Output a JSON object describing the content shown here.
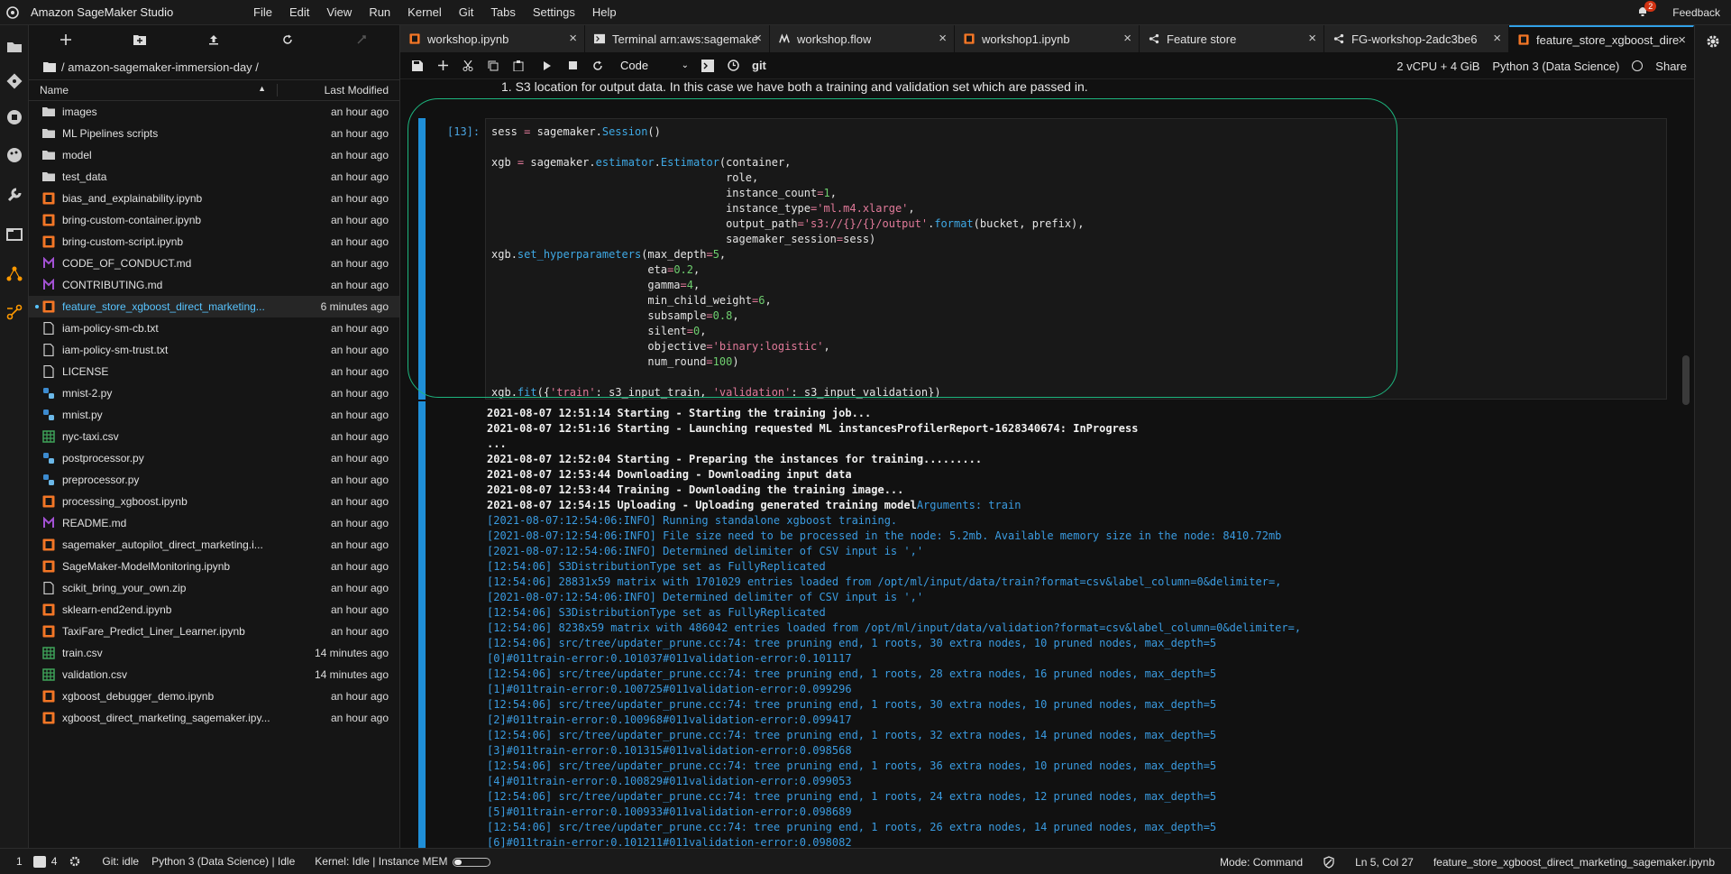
{
  "menubar": {
    "app_title": "Amazon SageMaker Studio",
    "menus": [
      "File",
      "Edit",
      "View",
      "Run",
      "Kernel",
      "Git",
      "Tabs",
      "Settings",
      "Help"
    ],
    "notification_count": "2",
    "feedback": "Feedback"
  },
  "filebrowser": {
    "breadcrumb": "/ amazon-sagemaker-immersion-day /",
    "col_name": "Name",
    "col_modified": "Last Modified",
    "files": [
      {
        "name": "images",
        "modified": "an hour ago",
        "icon": "folder-icon"
      },
      {
        "name": "ML Pipelines scripts",
        "modified": "an hour ago",
        "icon": "folder-icon"
      },
      {
        "name": "model",
        "modified": "an hour ago",
        "icon": "folder-icon"
      },
      {
        "name": "test_data",
        "modified": "an hour ago",
        "icon": "folder-icon"
      },
      {
        "name": "bias_and_explainability.ipynb",
        "modified": "an hour ago",
        "icon": "notebook-icon"
      },
      {
        "name": "bring-custom-container.ipynb",
        "modified": "an hour ago",
        "icon": "notebook-icon"
      },
      {
        "name": "bring-custom-script.ipynb",
        "modified": "an hour ago",
        "icon": "notebook-icon"
      },
      {
        "name": "CODE_OF_CONDUCT.md",
        "modified": "an hour ago",
        "icon": "markdown-icon"
      },
      {
        "name": "CONTRIBUTING.md",
        "modified": "an hour ago",
        "icon": "markdown-icon"
      },
      {
        "name": "feature_store_xgboost_direct_marketing...",
        "modified": "6 minutes ago",
        "icon": "notebook-icon"
      },
      {
        "name": "iam-policy-sm-cb.txt",
        "modified": "an hour ago",
        "icon": "file-icon"
      },
      {
        "name": "iam-policy-sm-trust.txt",
        "modified": "an hour ago",
        "icon": "file-icon"
      },
      {
        "name": "LICENSE",
        "modified": "an hour ago",
        "icon": "file-icon"
      },
      {
        "name": "mnist-2.py",
        "modified": "an hour ago",
        "icon": "python-icon"
      },
      {
        "name": "mnist.py",
        "modified": "an hour ago",
        "icon": "python-icon"
      },
      {
        "name": "nyc-taxi.csv",
        "modified": "an hour ago",
        "icon": "csv-icon"
      },
      {
        "name": "postprocessor.py",
        "modified": "an hour ago",
        "icon": "python-icon"
      },
      {
        "name": "preprocessor.py",
        "modified": "an hour ago",
        "icon": "python-icon"
      },
      {
        "name": "processing_xgboost.ipynb",
        "modified": "an hour ago",
        "icon": "notebook-icon"
      },
      {
        "name": "README.md",
        "modified": "an hour ago",
        "icon": "markdown-icon"
      },
      {
        "name": "sagemaker_autopilot_direct_marketing.i...",
        "modified": "an hour ago",
        "icon": "notebook-icon"
      },
      {
        "name": "SageMaker-ModelMonitoring.ipynb",
        "modified": "an hour ago",
        "icon": "notebook-icon"
      },
      {
        "name": "scikit_bring_your_own.zip",
        "modified": "an hour ago",
        "icon": "file-icon"
      },
      {
        "name": "sklearn-end2end.ipynb",
        "modified": "an hour ago",
        "icon": "notebook-icon"
      },
      {
        "name": "TaxiFare_Predict_Liner_Learner.ipynb",
        "modified": "an hour ago",
        "icon": "notebook-icon"
      },
      {
        "name": "train.csv",
        "modified": "14 minutes ago",
        "icon": "csv-icon"
      },
      {
        "name": "validation.csv",
        "modified": "14 minutes ago",
        "icon": "csv-icon"
      },
      {
        "name": "xgboost_debugger_demo.ipynb",
        "modified": "an hour ago",
        "icon": "notebook-icon"
      },
      {
        "name": "xgboost_direct_marketing_sagemaker.ipy...",
        "modified": "an hour ago",
        "icon": "notebook-icon"
      }
    ]
  },
  "tabs": [
    {
      "label": "workshop.ipynb",
      "icon": "notebook-icon"
    },
    {
      "label": "Terminal arn:aws:sagemake",
      "icon": "terminal-icon"
    },
    {
      "label": "workshop.flow",
      "icon": "flow-icon"
    },
    {
      "label": "workshop1.ipynb",
      "icon": "notebook-icon"
    },
    {
      "label": "Feature store",
      "icon": "feature-store-icon"
    },
    {
      "label": "FG-workshop-2adc3be6",
      "icon": "feature-group-icon"
    },
    {
      "label": "feature_store_xgboost_dire",
      "icon": "notebook-icon"
    }
  ],
  "nbtoolbar": {
    "cell_type": "Code",
    "git": "git",
    "instance": "2 vCPU + 4 GiB",
    "kernel": "Python 3 (Data Science)",
    "share": "Share"
  },
  "notebook": {
    "markdown_line": "1. S3 location for output data. In this case we have both a training and validation set which are passed in.",
    "prompt": "[13]:",
    "output_lines": [
      {
        "t": "2021-08-07 12:51:14 Starting - Starting the training job...",
        "c": "stdout"
      },
      {
        "t": "2021-08-07 12:51:16 Starting - Launching requested ML instancesProfilerReport-1628340674: InProgress",
        "c": "stdout"
      },
      {
        "t": "...",
        "c": "stdout"
      },
      {
        "t": "2021-08-07 12:52:04 Starting - Preparing the instances for training.........",
        "c": "stdout"
      },
      {
        "t": "2021-08-07 12:53:44 Downloading - Downloading input data",
        "c": "stdout"
      },
      {
        "t": "2021-08-07 12:53:44 Training - Downloading the training image...",
        "c": "stdout"
      },
      {
        "t": "2021-08-07 12:54:15 Uploading - Uploading generated training model",
        "c": "stdout",
        "tail": "Arguments: train"
      },
      {
        "t": "[2021-08-07:12:54:06:INFO] Running standalone xgboost training.",
        "c": "log"
      },
      {
        "t": "[2021-08-07:12:54:06:INFO] File size need to be processed in the node: 5.2mb. Available memory size in the node: 8410.72mb",
        "c": "log"
      },
      {
        "t": "[2021-08-07:12:54:06:INFO] Determined delimiter of CSV input is ','",
        "c": "log"
      },
      {
        "t": "[12:54:06] S3DistributionType set as FullyReplicated",
        "c": "log"
      },
      {
        "t": "[12:54:06] 28831x59 matrix with 1701029 entries loaded from /opt/ml/input/data/train?format=csv&label_column=0&delimiter=,",
        "c": "log"
      },
      {
        "t": "[2021-08-07:12:54:06:INFO] Determined delimiter of CSV input is ','",
        "c": "log"
      },
      {
        "t": "[12:54:06] S3DistributionType set as FullyReplicated",
        "c": "log"
      },
      {
        "t": "[12:54:06] 8238x59 matrix with 486042 entries loaded from /opt/ml/input/data/validation?format=csv&label_column=0&delimiter=,",
        "c": "log"
      },
      {
        "t": "[12:54:06] src/tree/updater_prune.cc:74: tree pruning end, 1 roots, 30 extra nodes, 10 pruned nodes, max_depth=5",
        "c": "log"
      },
      {
        "t": "[0]#011train-error:0.101037#011validation-error:0.101117",
        "c": "log"
      },
      {
        "t": "[12:54:06] src/tree/updater_prune.cc:74: tree pruning end, 1 roots, 28 extra nodes, 16 pruned nodes, max_depth=5",
        "c": "log"
      },
      {
        "t": "[1]#011train-error:0.100725#011validation-error:0.099296",
        "c": "log"
      },
      {
        "t": "[12:54:06] src/tree/updater_prune.cc:74: tree pruning end, 1 roots, 30 extra nodes, 10 pruned nodes, max_depth=5",
        "c": "log"
      },
      {
        "t": "[2]#011train-error:0.100968#011validation-error:0.099417",
        "c": "log"
      },
      {
        "t": "[12:54:06] src/tree/updater_prune.cc:74: tree pruning end, 1 roots, 32 extra nodes, 14 pruned nodes, max_depth=5",
        "c": "log"
      },
      {
        "t": "[3]#011train-error:0.101315#011validation-error:0.098568",
        "c": "log"
      },
      {
        "t": "[12:54:06] src/tree/updater_prune.cc:74: tree pruning end, 1 roots, 36 extra nodes, 10 pruned nodes, max_depth=5",
        "c": "log"
      },
      {
        "t": "[4]#011train-error:0.100829#011validation-error:0.099053",
        "c": "log"
      },
      {
        "t": "[12:54:06] src/tree/updater_prune.cc:74: tree pruning end, 1 roots, 24 extra nodes, 12 pruned nodes, max_depth=5",
        "c": "log"
      },
      {
        "t": "[5]#011train-error:0.100933#011validation-error:0.098689",
        "c": "log"
      },
      {
        "t": "[12:54:06] src/tree/updater_prune.cc:74: tree pruning end, 1 roots, 26 extra nodes, 14 pruned nodes, max_depth=5",
        "c": "log"
      },
      {
        "t": "[6]#011train-error:0.101211#011validation-error:0.098082",
        "c": "log"
      }
    ]
  },
  "code_lines": [
    [
      [
        "sess ",
        ""
      ],
      [
        "=",
        "op"
      ],
      [
        " sagemaker",
        ""
      ],
      [
        ".",
        ""
      ],
      [
        "Session",
        "kw"
      ],
      [
        "()",
        ""
      ]
    ],
    [],
    [
      [
        "xgb ",
        ""
      ],
      [
        "=",
        "op"
      ],
      [
        " sagemaker",
        ""
      ],
      [
        ".",
        ""
      ],
      [
        "estimator",
        "kw"
      ],
      [
        ".",
        ""
      ],
      [
        "Estimator",
        "kw"
      ],
      [
        "(container,",
        ""
      ]
    ],
    [
      [
        "                                    role,",
        ""
      ]
    ],
    [
      [
        "                                    instance_count",
        ""
      ],
      [
        "=",
        "op"
      ],
      [
        "1",
        "num"
      ],
      [
        ",",
        ""
      ]
    ],
    [
      [
        "                                    instance_type",
        ""
      ],
      [
        "=",
        "op"
      ],
      [
        "'ml.m4.xlarge'",
        "str"
      ],
      [
        ",",
        ""
      ]
    ],
    [
      [
        "                                    output_path",
        ""
      ],
      [
        "=",
        "op"
      ],
      [
        "'s3://{}/{}/output'",
        "str"
      ],
      [
        ".",
        ""
      ],
      [
        "format",
        "kw"
      ],
      [
        "(bucket, prefix),",
        ""
      ]
    ],
    [
      [
        "                                    sagemaker_session",
        ""
      ],
      [
        "=",
        "op"
      ],
      [
        "sess)",
        ""
      ]
    ],
    [
      [
        "xgb",
        ""
      ],
      [
        ".",
        ""
      ],
      [
        "set_hyperparameters",
        "kw"
      ],
      [
        "(max_depth",
        ""
      ],
      [
        "=",
        "op"
      ],
      [
        "5",
        "num"
      ],
      [
        ",",
        ""
      ]
    ],
    [
      [
        "                        eta",
        ""
      ],
      [
        "=",
        "op"
      ],
      [
        "0.2",
        "num"
      ],
      [
        ",",
        ""
      ]
    ],
    [
      [
        "                        gamma",
        ""
      ],
      [
        "=",
        "op"
      ],
      [
        "4",
        "num"
      ],
      [
        ",",
        ""
      ]
    ],
    [
      [
        "                        min_child_weight",
        ""
      ],
      [
        "=",
        "op"
      ],
      [
        "6",
        "num"
      ],
      [
        ",",
        ""
      ]
    ],
    [
      [
        "                        subsample",
        ""
      ],
      [
        "=",
        "op"
      ],
      [
        "0.8",
        "num"
      ],
      [
        ",",
        ""
      ]
    ],
    [
      [
        "                        silent",
        ""
      ],
      [
        "=",
        "op"
      ],
      [
        "0",
        "num"
      ],
      [
        ",",
        ""
      ]
    ],
    [
      [
        "                        objective",
        ""
      ],
      [
        "=",
        "op"
      ],
      [
        "'binary:logistic'",
        "str"
      ],
      [
        ",",
        ""
      ]
    ],
    [
      [
        "                        num_round",
        ""
      ],
      [
        "=",
        "op"
      ],
      [
        "100",
        "num"
      ],
      [
        ")",
        ""
      ]
    ],
    [],
    [
      [
        "xgb",
        ""
      ],
      [
        ".",
        ""
      ],
      [
        "fit",
        "kw"
      ],
      [
        "({",
        ""
      ],
      [
        "'train'",
        "str"
      ],
      [
        ": s3_input_train, ",
        ""
      ],
      [
        "'validation'",
        "str"
      ],
      [
        ": s3_input_validation})",
        ""
      ]
    ]
  ],
  "statusbar": {
    "count1": "1",
    "count2": "4",
    "git": "Git: idle",
    "kernel_status": "Python 3 (Data Science) | Idle",
    "kernel_mem": "Kernel: Idle | Instance MEM",
    "mode": "Mode: Command",
    "cursor": "Ln 5, Col 27",
    "filename": "feature_store_xgboost_direct_marketing_sagemaker.ipynb"
  },
  "colors": {
    "accent": "#31a0e7",
    "log_text": "#3a9be0",
    "highlight": "#1db57e",
    "notebook_icon": "#f37626"
  }
}
